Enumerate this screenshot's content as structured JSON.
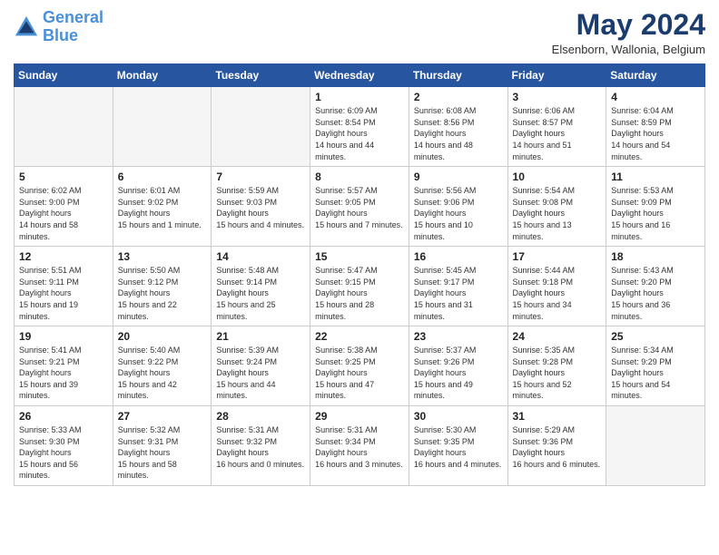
{
  "header": {
    "logo_line1": "General",
    "logo_line2": "Blue",
    "month_year": "May 2024",
    "location": "Elsenborn, Wallonia, Belgium"
  },
  "days_of_week": [
    "Sunday",
    "Monday",
    "Tuesday",
    "Wednesday",
    "Thursday",
    "Friday",
    "Saturday"
  ],
  "weeks": [
    [
      {
        "day": "",
        "empty": true
      },
      {
        "day": "",
        "empty": true
      },
      {
        "day": "",
        "empty": true
      },
      {
        "day": "1",
        "sunrise": "6:09 AM",
        "sunset": "8:54 PM",
        "daylight": "14 hours and 44 minutes."
      },
      {
        "day": "2",
        "sunrise": "6:08 AM",
        "sunset": "8:56 PM",
        "daylight": "14 hours and 48 minutes."
      },
      {
        "day": "3",
        "sunrise": "6:06 AM",
        "sunset": "8:57 PM",
        "daylight": "14 hours and 51 minutes."
      },
      {
        "day": "4",
        "sunrise": "6:04 AM",
        "sunset": "8:59 PM",
        "daylight": "14 hours and 54 minutes."
      }
    ],
    [
      {
        "day": "5",
        "sunrise": "6:02 AM",
        "sunset": "9:00 PM",
        "daylight": "14 hours and 58 minutes."
      },
      {
        "day": "6",
        "sunrise": "6:01 AM",
        "sunset": "9:02 PM",
        "daylight": "15 hours and 1 minute."
      },
      {
        "day": "7",
        "sunrise": "5:59 AM",
        "sunset": "9:03 PM",
        "daylight": "15 hours and 4 minutes."
      },
      {
        "day": "8",
        "sunrise": "5:57 AM",
        "sunset": "9:05 PM",
        "daylight": "15 hours and 7 minutes."
      },
      {
        "day": "9",
        "sunrise": "5:56 AM",
        "sunset": "9:06 PM",
        "daylight": "15 hours and 10 minutes."
      },
      {
        "day": "10",
        "sunrise": "5:54 AM",
        "sunset": "9:08 PM",
        "daylight": "15 hours and 13 minutes."
      },
      {
        "day": "11",
        "sunrise": "5:53 AM",
        "sunset": "9:09 PM",
        "daylight": "15 hours and 16 minutes."
      }
    ],
    [
      {
        "day": "12",
        "sunrise": "5:51 AM",
        "sunset": "9:11 PM",
        "daylight": "15 hours and 19 minutes."
      },
      {
        "day": "13",
        "sunrise": "5:50 AM",
        "sunset": "9:12 PM",
        "daylight": "15 hours and 22 minutes."
      },
      {
        "day": "14",
        "sunrise": "5:48 AM",
        "sunset": "9:14 PM",
        "daylight": "15 hours and 25 minutes."
      },
      {
        "day": "15",
        "sunrise": "5:47 AM",
        "sunset": "9:15 PM",
        "daylight": "15 hours and 28 minutes."
      },
      {
        "day": "16",
        "sunrise": "5:45 AM",
        "sunset": "9:17 PM",
        "daylight": "15 hours and 31 minutes."
      },
      {
        "day": "17",
        "sunrise": "5:44 AM",
        "sunset": "9:18 PM",
        "daylight": "15 hours and 34 minutes."
      },
      {
        "day": "18",
        "sunrise": "5:43 AM",
        "sunset": "9:20 PM",
        "daylight": "15 hours and 36 minutes."
      }
    ],
    [
      {
        "day": "19",
        "sunrise": "5:41 AM",
        "sunset": "9:21 PM",
        "daylight": "15 hours and 39 minutes."
      },
      {
        "day": "20",
        "sunrise": "5:40 AM",
        "sunset": "9:22 PM",
        "daylight": "15 hours and 42 minutes."
      },
      {
        "day": "21",
        "sunrise": "5:39 AM",
        "sunset": "9:24 PM",
        "daylight": "15 hours and 44 minutes."
      },
      {
        "day": "22",
        "sunrise": "5:38 AM",
        "sunset": "9:25 PM",
        "daylight": "15 hours and 47 minutes."
      },
      {
        "day": "23",
        "sunrise": "5:37 AM",
        "sunset": "9:26 PM",
        "daylight": "15 hours and 49 minutes."
      },
      {
        "day": "24",
        "sunrise": "5:35 AM",
        "sunset": "9:28 PM",
        "daylight": "15 hours and 52 minutes."
      },
      {
        "day": "25",
        "sunrise": "5:34 AM",
        "sunset": "9:29 PM",
        "daylight": "15 hours and 54 minutes."
      }
    ],
    [
      {
        "day": "26",
        "sunrise": "5:33 AM",
        "sunset": "9:30 PM",
        "daylight": "15 hours and 56 minutes."
      },
      {
        "day": "27",
        "sunrise": "5:32 AM",
        "sunset": "9:31 PM",
        "daylight": "15 hours and 58 minutes."
      },
      {
        "day": "28",
        "sunrise": "5:31 AM",
        "sunset": "9:32 PM",
        "daylight": "16 hours and 0 minutes."
      },
      {
        "day": "29",
        "sunrise": "5:31 AM",
        "sunset": "9:34 PM",
        "daylight": "16 hours and 3 minutes."
      },
      {
        "day": "30",
        "sunrise": "5:30 AM",
        "sunset": "9:35 PM",
        "daylight": "16 hours and 4 minutes."
      },
      {
        "day": "31",
        "sunrise": "5:29 AM",
        "sunset": "9:36 PM",
        "daylight": "16 hours and 6 minutes."
      },
      {
        "day": "",
        "empty": true
      }
    ]
  ]
}
